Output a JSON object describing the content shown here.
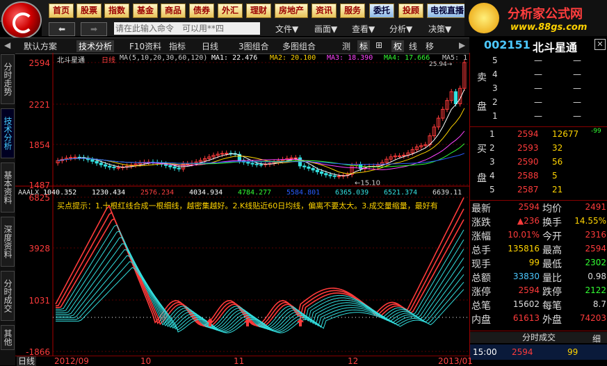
{
  "menu": [
    "首页",
    "股票",
    "指数",
    "基金",
    "商品",
    "债券",
    "外汇",
    "理财",
    "房地产",
    "资讯",
    "服务",
    "委托",
    "投顾",
    "电视直播"
  ],
  "brand": {
    "title": "分析家公式网",
    "url": "www.88gs.com"
  },
  "toolbar2": {
    "cmd_placeholder": "请在此输入命令　可以用**四",
    "menus": [
      "文件▼",
      "画面▼",
      "查看▼",
      "分析▼",
      "决策▼"
    ]
  },
  "toolbar3": {
    "items": [
      "默认方案",
      "技术分析",
      "F10资料",
      "指标",
      "日线",
      "3图组合",
      "多图组合",
      "测",
      "标",
      "⊞",
      "权",
      "线",
      "移"
    ]
  },
  "stock": {
    "code": "002151",
    "name": "北斗星通"
  },
  "lefttabs": [
    "分时走势",
    "技术分析",
    "基本资料",
    "深度资料",
    "分时成交",
    "其他"
  ],
  "chart": {
    "header": {
      "name": "北斗星通",
      "period": "日线",
      "ma_title": "MA(5,10,20,30,60,120)",
      "ma1": "MA1: 22.476",
      "ma2": "MA2: 20.100",
      "ma3": "MA3: 18.390",
      "ma4": "MA4: 17.666",
      "ma5": "MA5: 1"
    },
    "price_ticks": [
      "2594",
      "2221",
      "1854",
      "1487"
    ],
    "low_label": "15.10",
    "high_label": "25.94",
    "ind_header": {
      "name": "AAALX",
      "v1": "1040.352",
      "v2": "1230.434",
      "v3": "2576.234",
      "v4": "4034.934",
      "v5": "4784.277",
      "v6": "5584.801",
      "v7": "6365.039",
      "v8": "6521.374",
      "v9": "6639.11"
    },
    "ind_ticks": [
      "6825",
      "3928",
      "1031",
      "-1866"
    ],
    "tip": "买点提示：1.十根红线合成一根细线，越密集越好。2.K线贴近60日均线，偏离不要太大。3.成交量缩量，最好有",
    "dates": [
      "2012/09",
      "10",
      "11",
      "12",
      "2013/01"
    ],
    "period_label": "日线"
  },
  "quote": {
    "sell": [
      {
        "lv": "5",
        "p": "—",
        "v": "—"
      },
      {
        "lv": "4",
        "p": "—",
        "v": "—"
      },
      {
        "lv": "3",
        "p": "—",
        "v": "—"
      },
      {
        "lv": "2",
        "p": "—",
        "v": "—"
      },
      {
        "lv": "1",
        "p": "—",
        "v": "—"
      }
    ],
    "sell_label": [
      "卖",
      "盘"
    ],
    "buy": [
      {
        "lv": "1",
        "p": "2594",
        "v": "12677",
        "x": "-99"
      },
      {
        "lv": "2",
        "p": "2593",
        "v": "32"
      },
      {
        "lv": "3",
        "p": "2590",
        "v": "56"
      },
      {
        "lv": "4",
        "p": "2588",
        "v": "5"
      },
      {
        "lv": "5",
        "p": "2587",
        "v": "21"
      }
    ],
    "buy_label": [
      "买",
      "盘"
    ],
    "stats": [
      {
        "k1": "最新",
        "v1": "2594",
        "k2": "均价",
        "v2": "2491"
      },
      {
        "k1": "涨跌",
        "v1": "▲236",
        "k2": "换手",
        "v2": "14.55%"
      },
      {
        "k1": "涨幅",
        "v1": "10.01%",
        "k2": "今开",
        "v2": "2316"
      },
      {
        "k1": "总手",
        "v1": "135816",
        "k2": "最高",
        "v2": "2594"
      },
      {
        "k1": "现手",
        "v1": "99",
        "k2": "最低",
        "v2": "2302"
      },
      {
        "k1": "总额",
        "v1": "33830",
        "k2": "量比",
        "v2": "0.98"
      },
      {
        "k1": "涨停",
        "v1": "2594",
        "k2": "跌停",
        "v2": "2122"
      },
      {
        "k1": "总笔",
        "v1": "15602",
        "k2": "每笔",
        "v2": "8.7"
      },
      {
        "k1": "内盘",
        "v1": "61613",
        "k2": "外盘",
        "v2": "74203"
      }
    ],
    "tabs": [
      "分时成交",
      "细"
    ],
    "trade": {
      "time": "15:00",
      "price": "2594",
      "vol": "99"
    }
  },
  "colors": {
    "up": "#ff3b3b",
    "down": "#33e0e0",
    "ma1": "#ffffff",
    "ma2": "#ffd400",
    "ma3": "#ff44ff",
    "ma4": "#33ff33",
    "grid": "#8b0000"
  }
}
